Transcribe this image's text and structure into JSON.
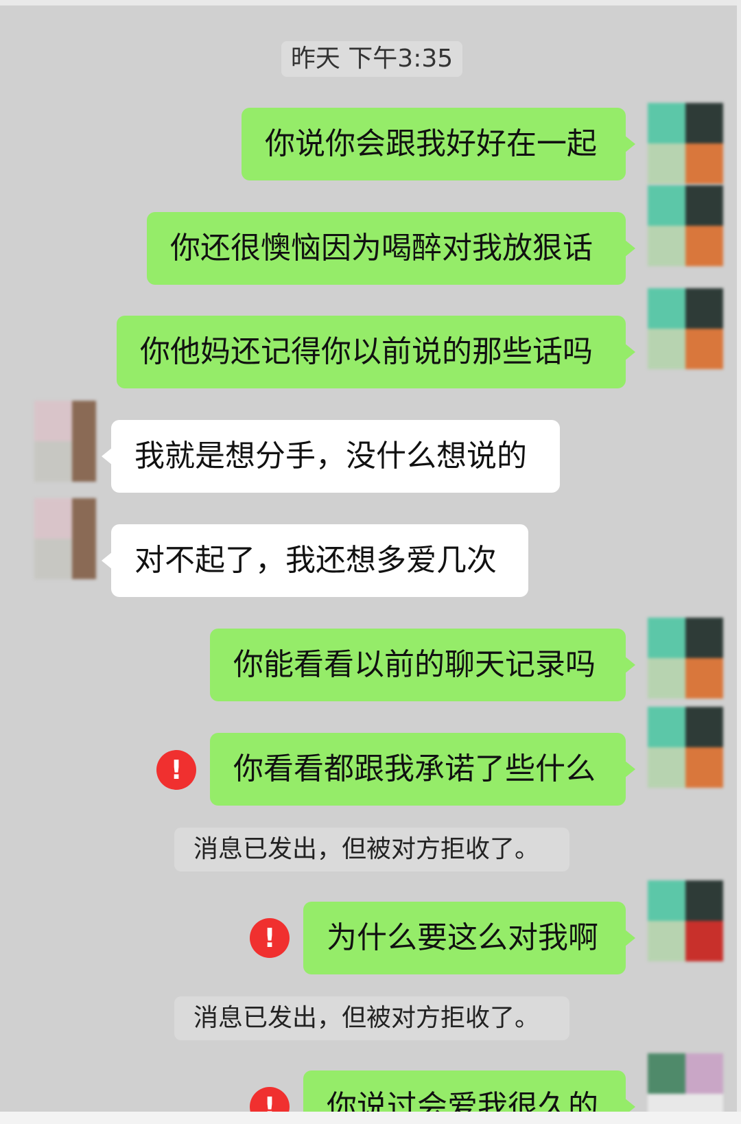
{
  "chat": {
    "timestamp": "昨天 下午3:35",
    "messages": [
      {
        "from": "me",
        "text": "你说你会跟我好好在一起"
      },
      {
        "from": "me",
        "text": "你还很懊恼因为喝醉对我放狠话"
      },
      {
        "from": "me",
        "text": "你他妈还记得你以前说的那些话吗"
      },
      {
        "from": "them",
        "text": "我就是想分手，没什么想说的"
      },
      {
        "from": "them",
        "text": "对不起了，我还想多爱几次"
      },
      {
        "from": "me",
        "text": "你能看看以前的聊天记录吗"
      },
      {
        "from": "me",
        "text": "你看看都跟我承诺了些什么",
        "status": "rejected"
      },
      {
        "from": "me",
        "text": "为什么要这么对我啊",
        "status": "rejected"
      },
      {
        "from": "me",
        "text": "你说过会爱我很久的",
        "status": "rejected"
      }
    ],
    "rejected_notice": "消息已发出，但被对方拒收了。",
    "error_icon_glyph": "!"
  },
  "colors": {
    "background": "#d0d0d0",
    "my_bubble": "#95ec69",
    "their_bubble": "#ffffff",
    "error": "#f0302f"
  }
}
